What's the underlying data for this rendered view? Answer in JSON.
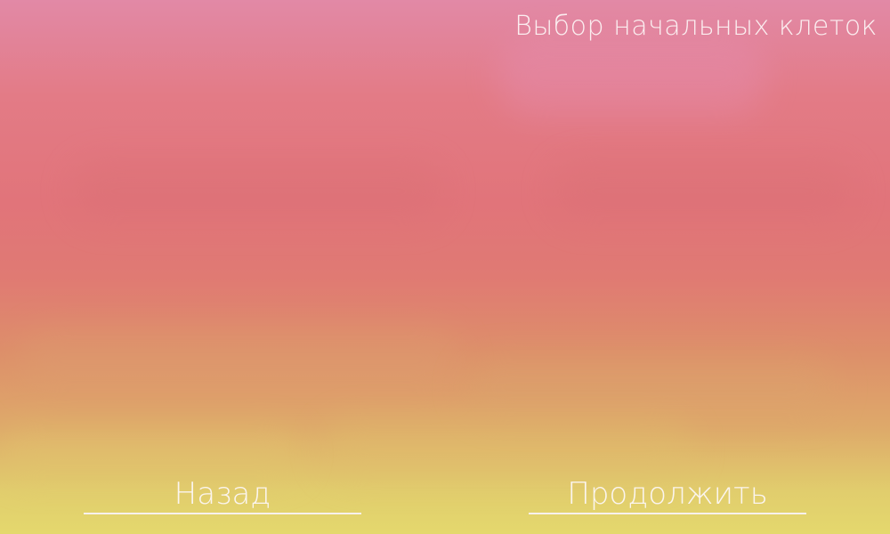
{
  "screen": {
    "title": "Выбор начальных клеток"
  },
  "navigation": {
    "back_label": "Назад",
    "continue_label": "Продолжить"
  },
  "colors": {
    "gradient_top": "#e289a6",
    "gradient_middle": "#e1747a",
    "gradient_bottom": "#e4d86d",
    "text": "#fbf5ef"
  }
}
